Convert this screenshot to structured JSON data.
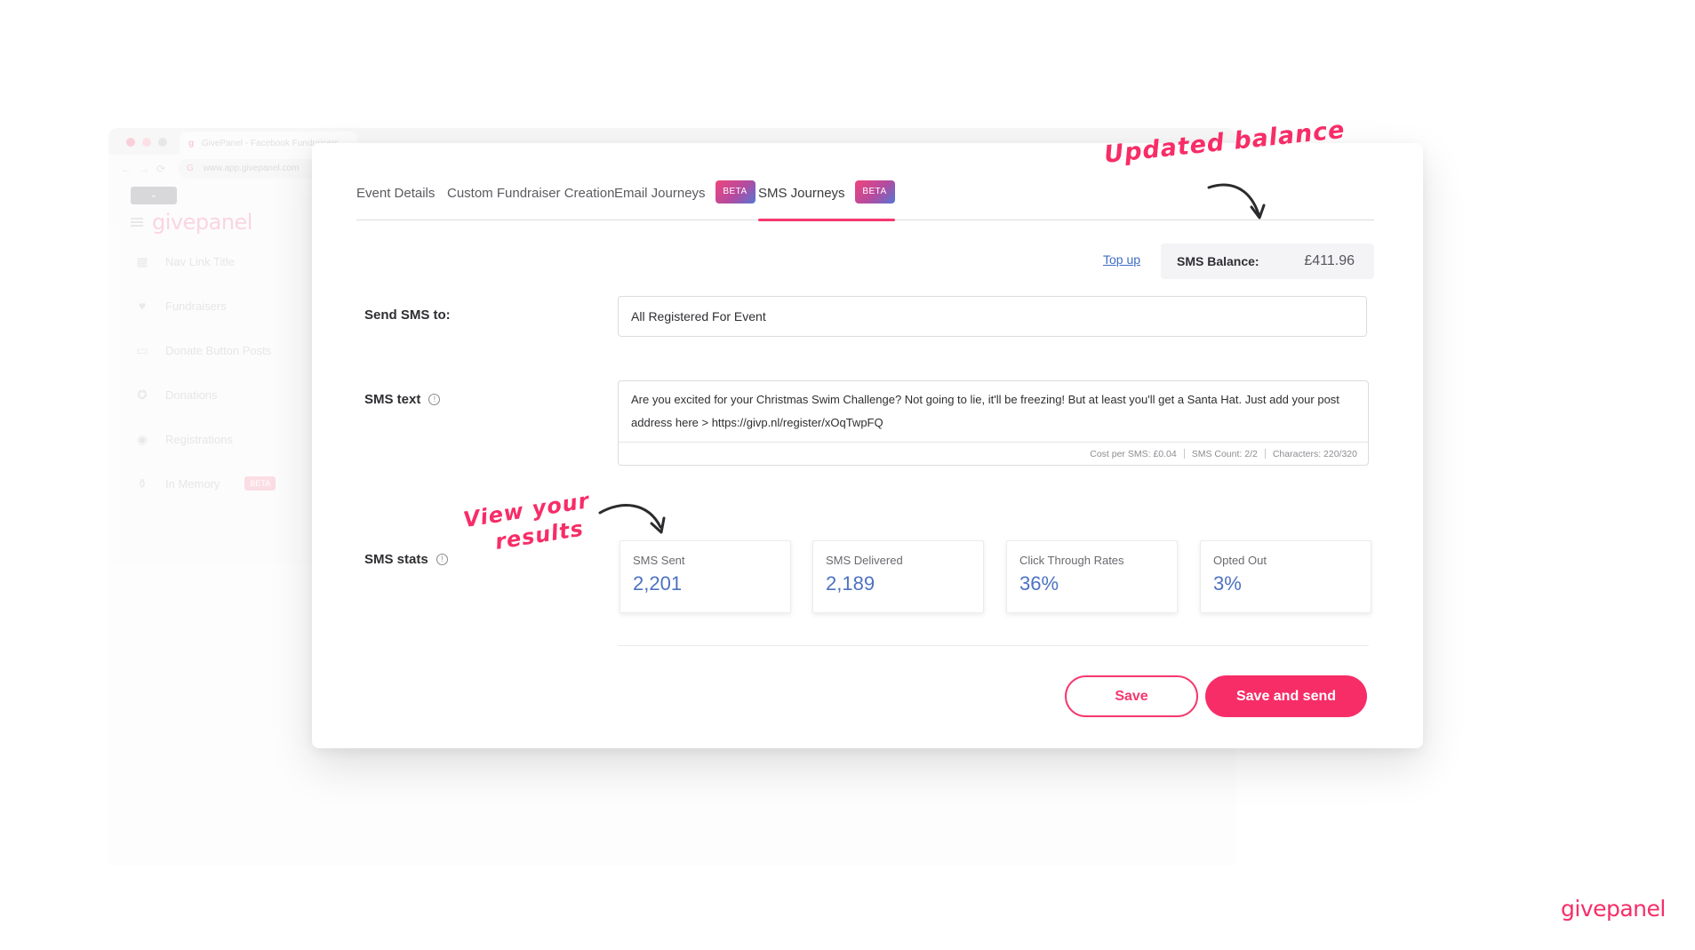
{
  "background_browser": {
    "tab_title": "GivePanel - Facebook Fundraisers",
    "favicon": "g",
    "url": "www.app.givepanel.com",
    "logo": "givepanel",
    "nav_back": "←",
    "nav_forward": "→",
    "nav_reload": "⟳",
    "toggle": "⌄",
    "sidebar": [
      {
        "label": "Nav Link Title",
        "icon": "grid-icon",
        "glyph": "▦"
      },
      {
        "label": "Fundraisers",
        "icon": "heart-icon",
        "glyph": "♥"
      },
      {
        "label": "Donate Button Posts",
        "icon": "post-icon",
        "glyph": "▭"
      },
      {
        "label": "Donations",
        "icon": "award-icon",
        "glyph": "✪"
      },
      {
        "label": "Registrations",
        "icon": "registration-icon",
        "glyph": "◉"
      },
      {
        "label": "In Memory",
        "icon": "memorial-icon",
        "glyph": "⚱",
        "badge": "BETA"
      }
    ]
  },
  "tabs": [
    {
      "label": "Event Details",
      "active": false
    },
    {
      "label": "Custom Fundraiser Creation",
      "active": false
    },
    {
      "label": "Email Journeys",
      "active": false,
      "badge": "BETA"
    },
    {
      "label": "SMS Journeys",
      "active": true,
      "badge": "BETA"
    }
  ],
  "annotations": {
    "balance": "Updated balance",
    "results_line1": "View your",
    "results_line2": "results"
  },
  "balance": {
    "topup_label": "Top up",
    "label": "SMS Balance:",
    "value": "£411.96"
  },
  "form": {
    "send_to_label": "Send SMS to:",
    "send_to_value": "All Registered For Event",
    "sms_text_label": "SMS text",
    "sms_text_value": "Are you excited for your Christmas Swim Challenge? Not going to lie, it'll be freezing! But at least you'll get a Santa Hat. Just add your post address here > https://givp.nl/register/xOqTwpFQ",
    "cost_per_sms": "Cost per SMS: £0.04",
    "sms_count": "SMS Count: 2/2",
    "characters": "Characters:  220/320",
    "stats_label": "SMS stats"
  },
  "stats": [
    {
      "label": "SMS Sent",
      "value": "2,201"
    },
    {
      "label": "SMS Delivered",
      "value": "2,189"
    },
    {
      "label": "Click Through Rates",
      "value": "36%"
    },
    {
      "label": "Opted Out",
      "value": "3%"
    }
  ],
  "buttons": {
    "save": "Save",
    "save_and_send": "Save and send"
  },
  "brand": "givepanel",
  "colors": {
    "accent": "#f72d67",
    "stat_value": "#4d72c2",
    "link": "#3f6dc4"
  }
}
